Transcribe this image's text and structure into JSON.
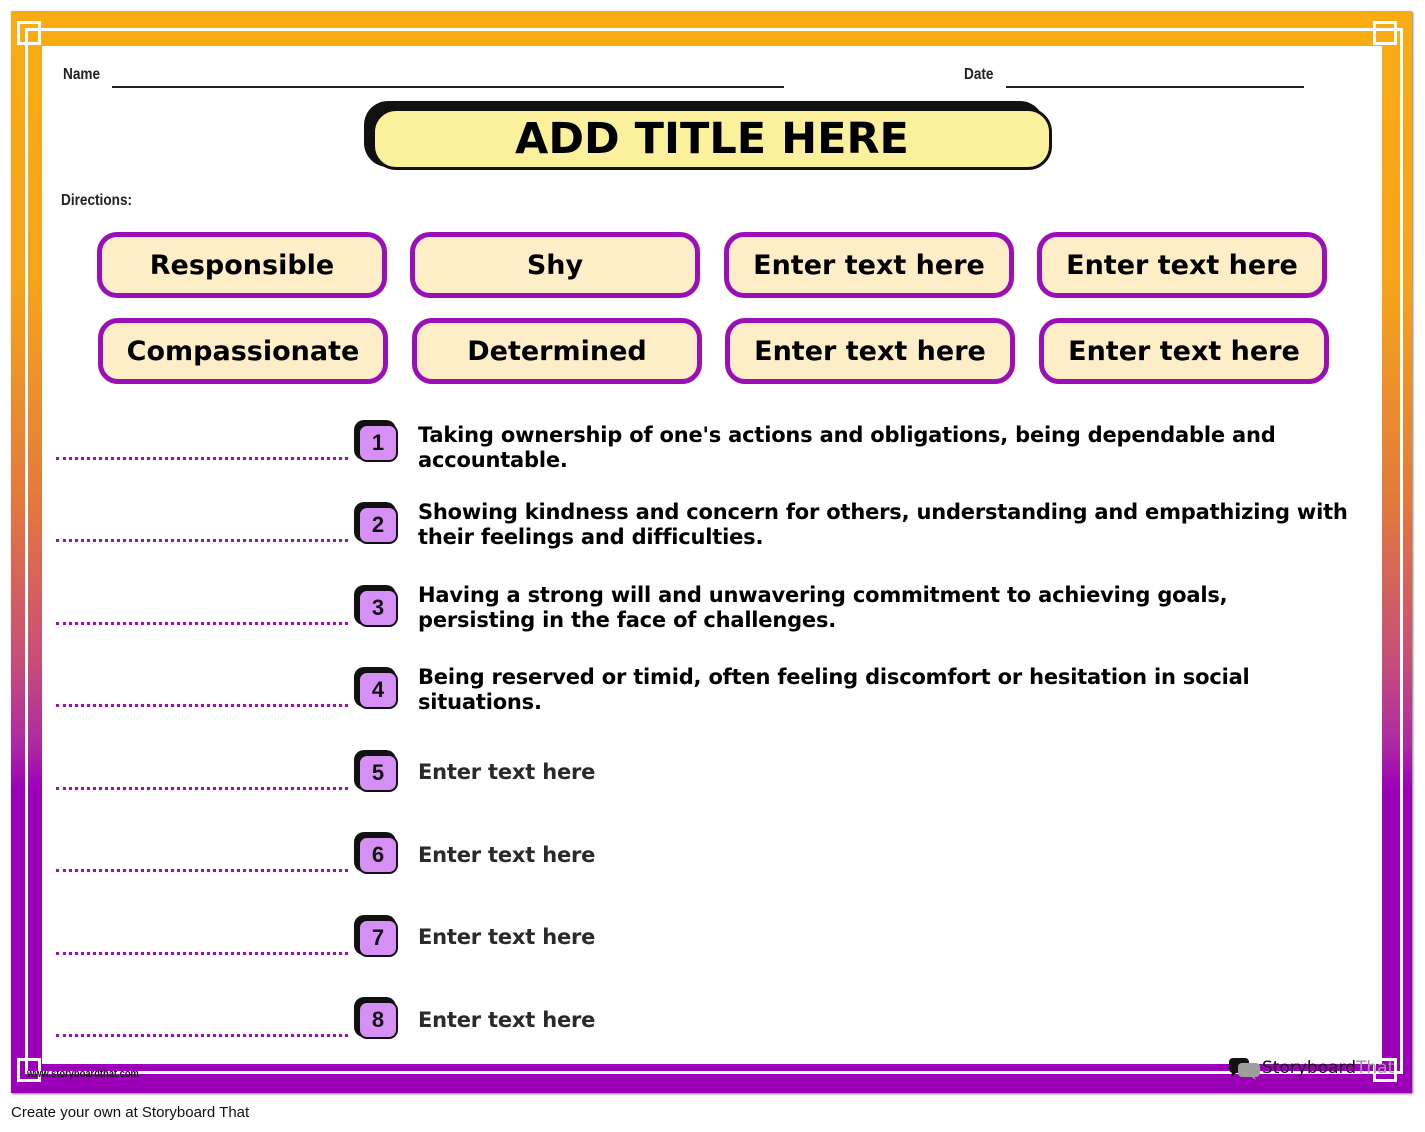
{
  "worksheet": {
    "name_label": "Name",
    "date_label": "Date",
    "title": "ADD TITLE HERE",
    "directions_label": "Directions:",
    "word_bank": [
      "Responsible",
      "Shy",
      "Enter text here",
      "Enter text here",
      "Compassionate",
      "Determined",
      "Enter text here",
      "Enter text here"
    ],
    "questions": [
      {
        "number": "1",
        "text": "Taking ownership of one's actions and obligations, being dependable and accountable."
      },
      {
        "number": "2",
        "text": "Showing kindness and concern for others, understanding and empathizing with their feelings and difficulties."
      },
      {
        "number": "3",
        "text": "Having a strong will and unwavering commitment to achieving goals, persisting in the face of challenges."
      },
      {
        "number": "4",
        "text": "Being reserved or timid, often feeling discomfort or hesitation in social situations."
      },
      {
        "number": "5",
        "text": "Enter text here"
      },
      {
        "number": "6",
        "text": "Enter text here"
      },
      {
        "number": "7",
        "text": "Enter text here"
      },
      {
        "number": "8",
        "text": "Enter text here"
      }
    ],
    "site_url": "www.storyboardthat.com",
    "logo_part1": "Storyboard",
    "logo_part2": "That"
  },
  "caption": "Create your own at Storyboard That",
  "colors": {
    "border_top": "#f9ac12",
    "border_bottom": "#9b00b8",
    "word_box_fill": "#fdeec8",
    "word_box_border": "#9a0fb8",
    "title_fill": "#fbf19d",
    "number_fill": "#d690f5"
  }
}
